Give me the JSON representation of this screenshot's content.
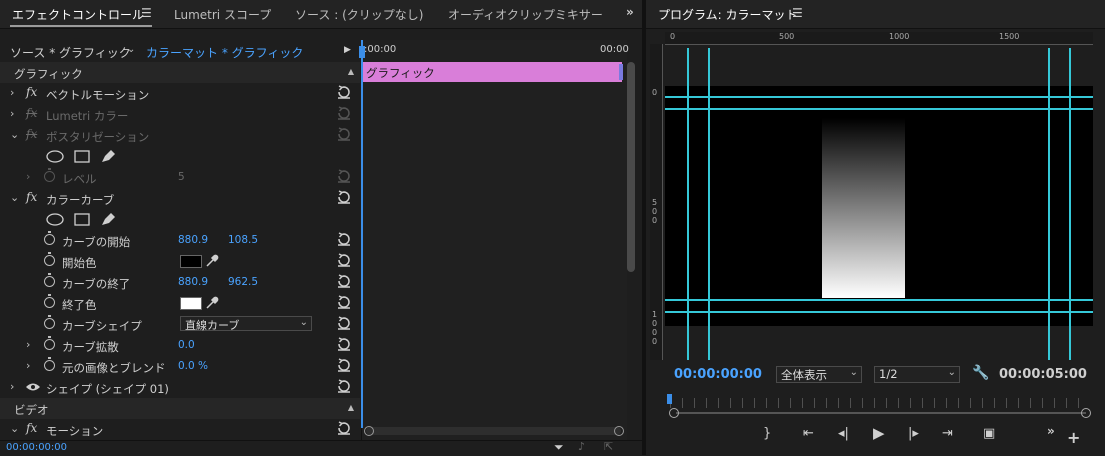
{
  "effects_panel": {
    "tabs": [
      "エフェクトコントロール",
      "Lumetri スコープ",
      "ソース : (クリップなし)",
      "オーディオクリップミキサー : カ"
    ],
    "source_label": "ソース * グラフィック",
    "clip_label": "カラーマット * グラフィック",
    "timeline": {
      "start_tc": ":00:00",
      "end_tc": "00:00",
      "clip_name": "グラフィック"
    },
    "section_graphic": "グラフィック",
    "vector_motion": "ベクトルモーション",
    "lumetri": "Lumetri カラー",
    "posterize": "ポスタリゼーション",
    "level_label": "レベル",
    "level_value": "5",
    "color_curve": "カラーカーブ",
    "curve_start": {
      "label": "カーブの開始",
      "x": "880.9",
      "y": "108.5"
    },
    "start_color": "開始色",
    "curve_end": {
      "label": "カーブの終了",
      "x": "880.9",
      "y": "962.5"
    },
    "end_color": "終了色",
    "curve_shape": {
      "label": "カーブシェイプ",
      "value": "直線カーブ"
    },
    "curve_spread": {
      "label": "カーブ拡散",
      "value": "0.0"
    },
    "blend": {
      "label": "元の画像とブレンド",
      "value": "0.0 %"
    },
    "shape": "シェイプ (シェイプ 01)",
    "section_video": "ビデオ",
    "motion": "モーション",
    "timecode": "00:00:00:00"
  },
  "program": {
    "title": "プログラム: カラーマット",
    "ruler": [
      "0",
      "500",
      "1000",
      "1500"
    ],
    "vruler_0": "0",
    "vruler_500": [
      "5",
      "0",
      "0"
    ],
    "vruler_1000": [
      "1",
      "0",
      "0",
      "0"
    ],
    "timecode_left": "00:00:00:00",
    "zoom": "全体表示",
    "resolution": "1/2",
    "timecode_right": "00:00:05:00"
  },
  "colors": {
    "accent": "#4aa3ff",
    "clip": "#d97ed9",
    "guide": "#35c8d8"
  }
}
